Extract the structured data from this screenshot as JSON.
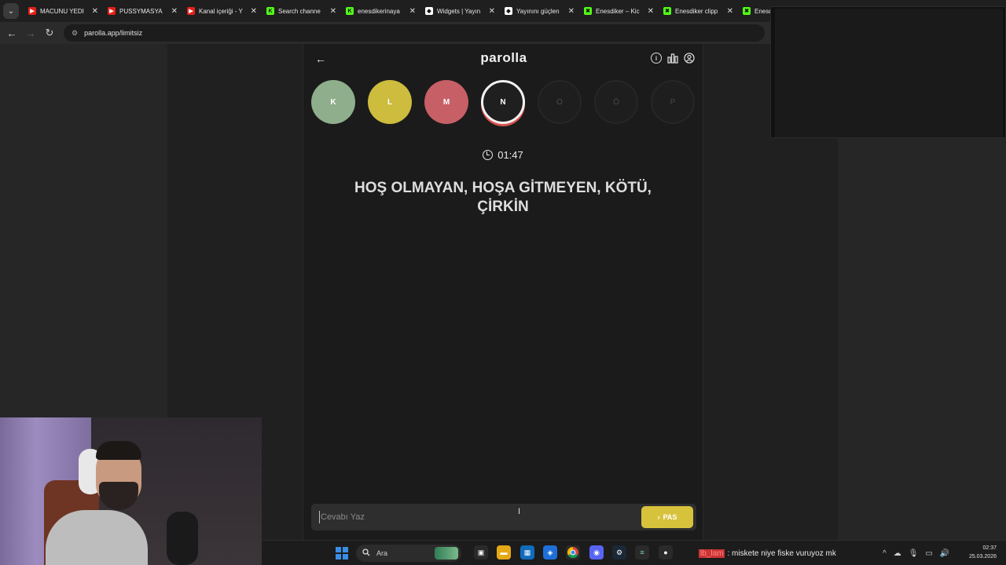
{
  "browser": {
    "tabs": [
      {
        "title": "MACUNU YEDI",
        "favicon_color": "#e62117",
        "favicon_glyph": "▶"
      },
      {
        "title": "PUSSYMASYA",
        "favicon_color": "#e62117",
        "favicon_glyph": "▶"
      },
      {
        "title": "Kanal içeriği - Y",
        "favicon_color": "#e62117",
        "favicon_glyph": "▶"
      },
      {
        "title": "Search channe",
        "favicon_color": "#53fc18",
        "favicon_glyph": "K"
      },
      {
        "title": "enesdikerinaya",
        "favicon_color": "#53fc18",
        "favicon_glyph": "K"
      },
      {
        "title": "Widgets | Yayın",
        "favicon_color": "#ffffff",
        "favicon_glyph": "◆"
      },
      {
        "title": "Yayınını güçlen",
        "favicon_color": "#ffffff",
        "favicon_glyph": "◆"
      },
      {
        "title": "Enesdiker – Kic",
        "favicon_color": "#53fc18",
        "favicon_glyph": "✖"
      },
      {
        "title": "Enesdiker clipp",
        "favicon_color": "#53fc18",
        "favicon_glyph": "✖"
      },
      {
        "title": "Enesdi",
        "favicon_color": "#53fc18",
        "favicon_glyph": "✖"
      }
    ],
    "close_glyph": "✕",
    "url": "parolla.app/limitsiz"
  },
  "app": {
    "logo": "parolla",
    "letters": [
      {
        "char": "K",
        "state": "correct",
        "color": "#8fae8c"
      },
      {
        "char": "L",
        "state": "passed",
        "color": "#cdbc3e"
      },
      {
        "char": "M",
        "state": "wrong",
        "color": "#c75f66"
      },
      {
        "char": "N",
        "state": "active",
        "color": "#1f1f1f"
      },
      {
        "char": "O",
        "state": "pending",
        "color": "#1e1e1e"
      },
      {
        "char": "Ö",
        "state": "pending",
        "color": "#1e1e1e"
      },
      {
        "char": "P",
        "state": "pending",
        "color": "#1e1e1e"
      }
    ],
    "timer": "01:47",
    "question": "HOŞ OLMAYAN, HOŞA GİTMEYEN, KÖTÜ, ÇİRKİN",
    "answer_placeholder": "Cevabı Yaz",
    "pass_label": "PAS",
    "accent": "#d7c23c"
  },
  "taskbar": {
    "search_placeholder": "Ara",
    "chat_user": "lb_lam",
    "chat_message": ": miskete niye fiske vuruyoz mk",
    "time": "02:37",
    "date": "25.03.2026"
  }
}
